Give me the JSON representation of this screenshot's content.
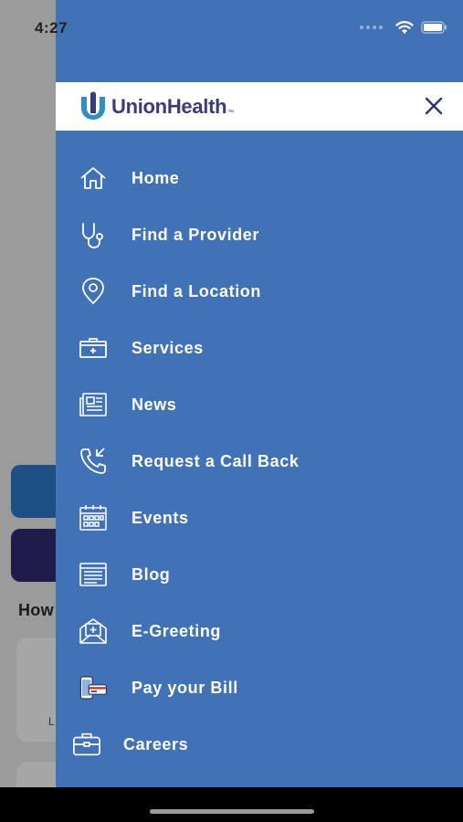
{
  "status_bar": {
    "time": "4:27",
    "icons": [
      "signal-dots-icon",
      "wifi-icon",
      "battery-icon"
    ]
  },
  "background": {
    "section_heading": "How",
    "tile_label": "L"
  },
  "drawer": {
    "logo_text": "UnionHealth",
    "logo_tm": "™",
    "close_icon": "close-icon",
    "accent_color": "#4072b5",
    "menu": [
      {
        "label": "Home",
        "icon": "home-icon"
      },
      {
        "label": "Find a Provider",
        "icon": "stethoscope-icon"
      },
      {
        "label": "Find a Location",
        "icon": "location-pin-icon"
      },
      {
        "label": "Services",
        "icon": "medical-kit-icon"
      },
      {
        "label": "News",
        "icon": "newspaper-icon"
      },
      {
        "label": "Request a Call Back",
        "icon": "phone-callback-icon"
      },
      {
        "label": "Events",
        "icon": "calendar-icon"
      },
      {
        "label": "Blog",
        "icon": "blog-icon"
      },
      {
        "label": "E-Greeting",
        "icon": "greeting-envelope-icon"
      },
      {
        "label": "Pay your Bill",
        "icon": "pay-bill-icon"
      },
      {
        "label": "Careers",
        "icon": "briefcase-icon"
      }
    ]
  }
}
